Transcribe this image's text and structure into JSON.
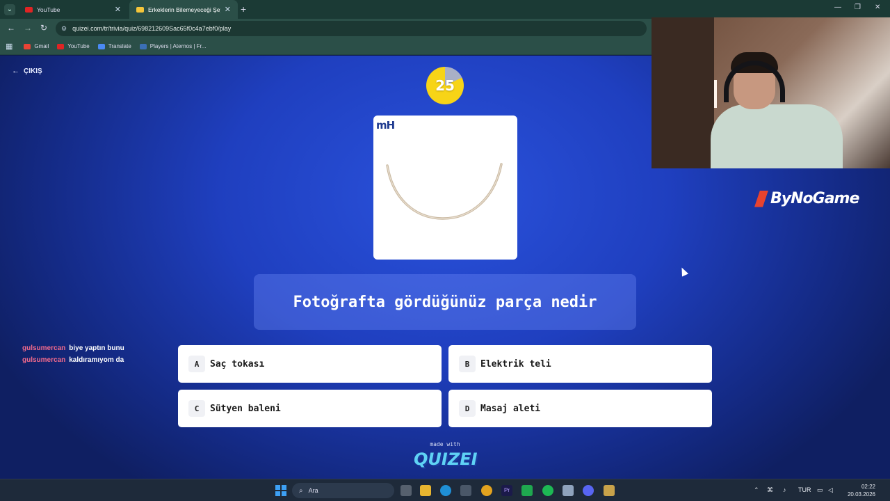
{
  "browser": {
    "tabs": [
      {
        "title": "YouTube",
        "active": false
      },
      {
        "title": "Erkeklerin Bilemeyeceği Şeyler",
        "active": true
      }
    ],
    "url": "quizei.com/tr/trivia/quiz/698212609Sac65f0c4a7ebf0/play",
    "bookmarks": [
      "Gmail",
      "YouTube",
      "Translate",
      "Players | Aternos | Fr..."
    ]
  },
  "quiz": {
    "exit_label": "ÇIKIŞ",
    "timer": "25",
    "timer_remaining_fraction": 0.82,
    "photo_brand": "mH",
    "question": "Fotoğrafta gördüğünüz parça nedir",
    "answers": [
      {
        "letter": "A",
        "text": "Saç tokası"
      },
      {
        "letter": "B",
        "text": "Elektrik teli"
      },
      {
        "letter": "C",
        "text": "Sütyen baleni"
      },
      {
        "letter": "D",
        "text": "Masaj aleti"
      }
    ],
    "made_with": "made with",
    "logo_text": "QUIZEI"
  },
  "chat": [
    {
      "user": "gulsumercan",
      "message": "biye yaptın bunu"
    },
    {
      "user": "gulsumercan",
      "message": "kaldıramıyom da"
    }
  ],
  "overlay": {
    "sponsor": "ByNoGame"
  },
  "taskbar": {
    "search_placeholder": "Ara",
    "language": "TUR",
    "time": "02:22",
    "date": "20.03.2026"
  },
  "colors": {
    "accent_timer": "#f7d417",
    "chat_user": "#f06a8c",
    "page_blue": "#2a52dc"
  }
}
